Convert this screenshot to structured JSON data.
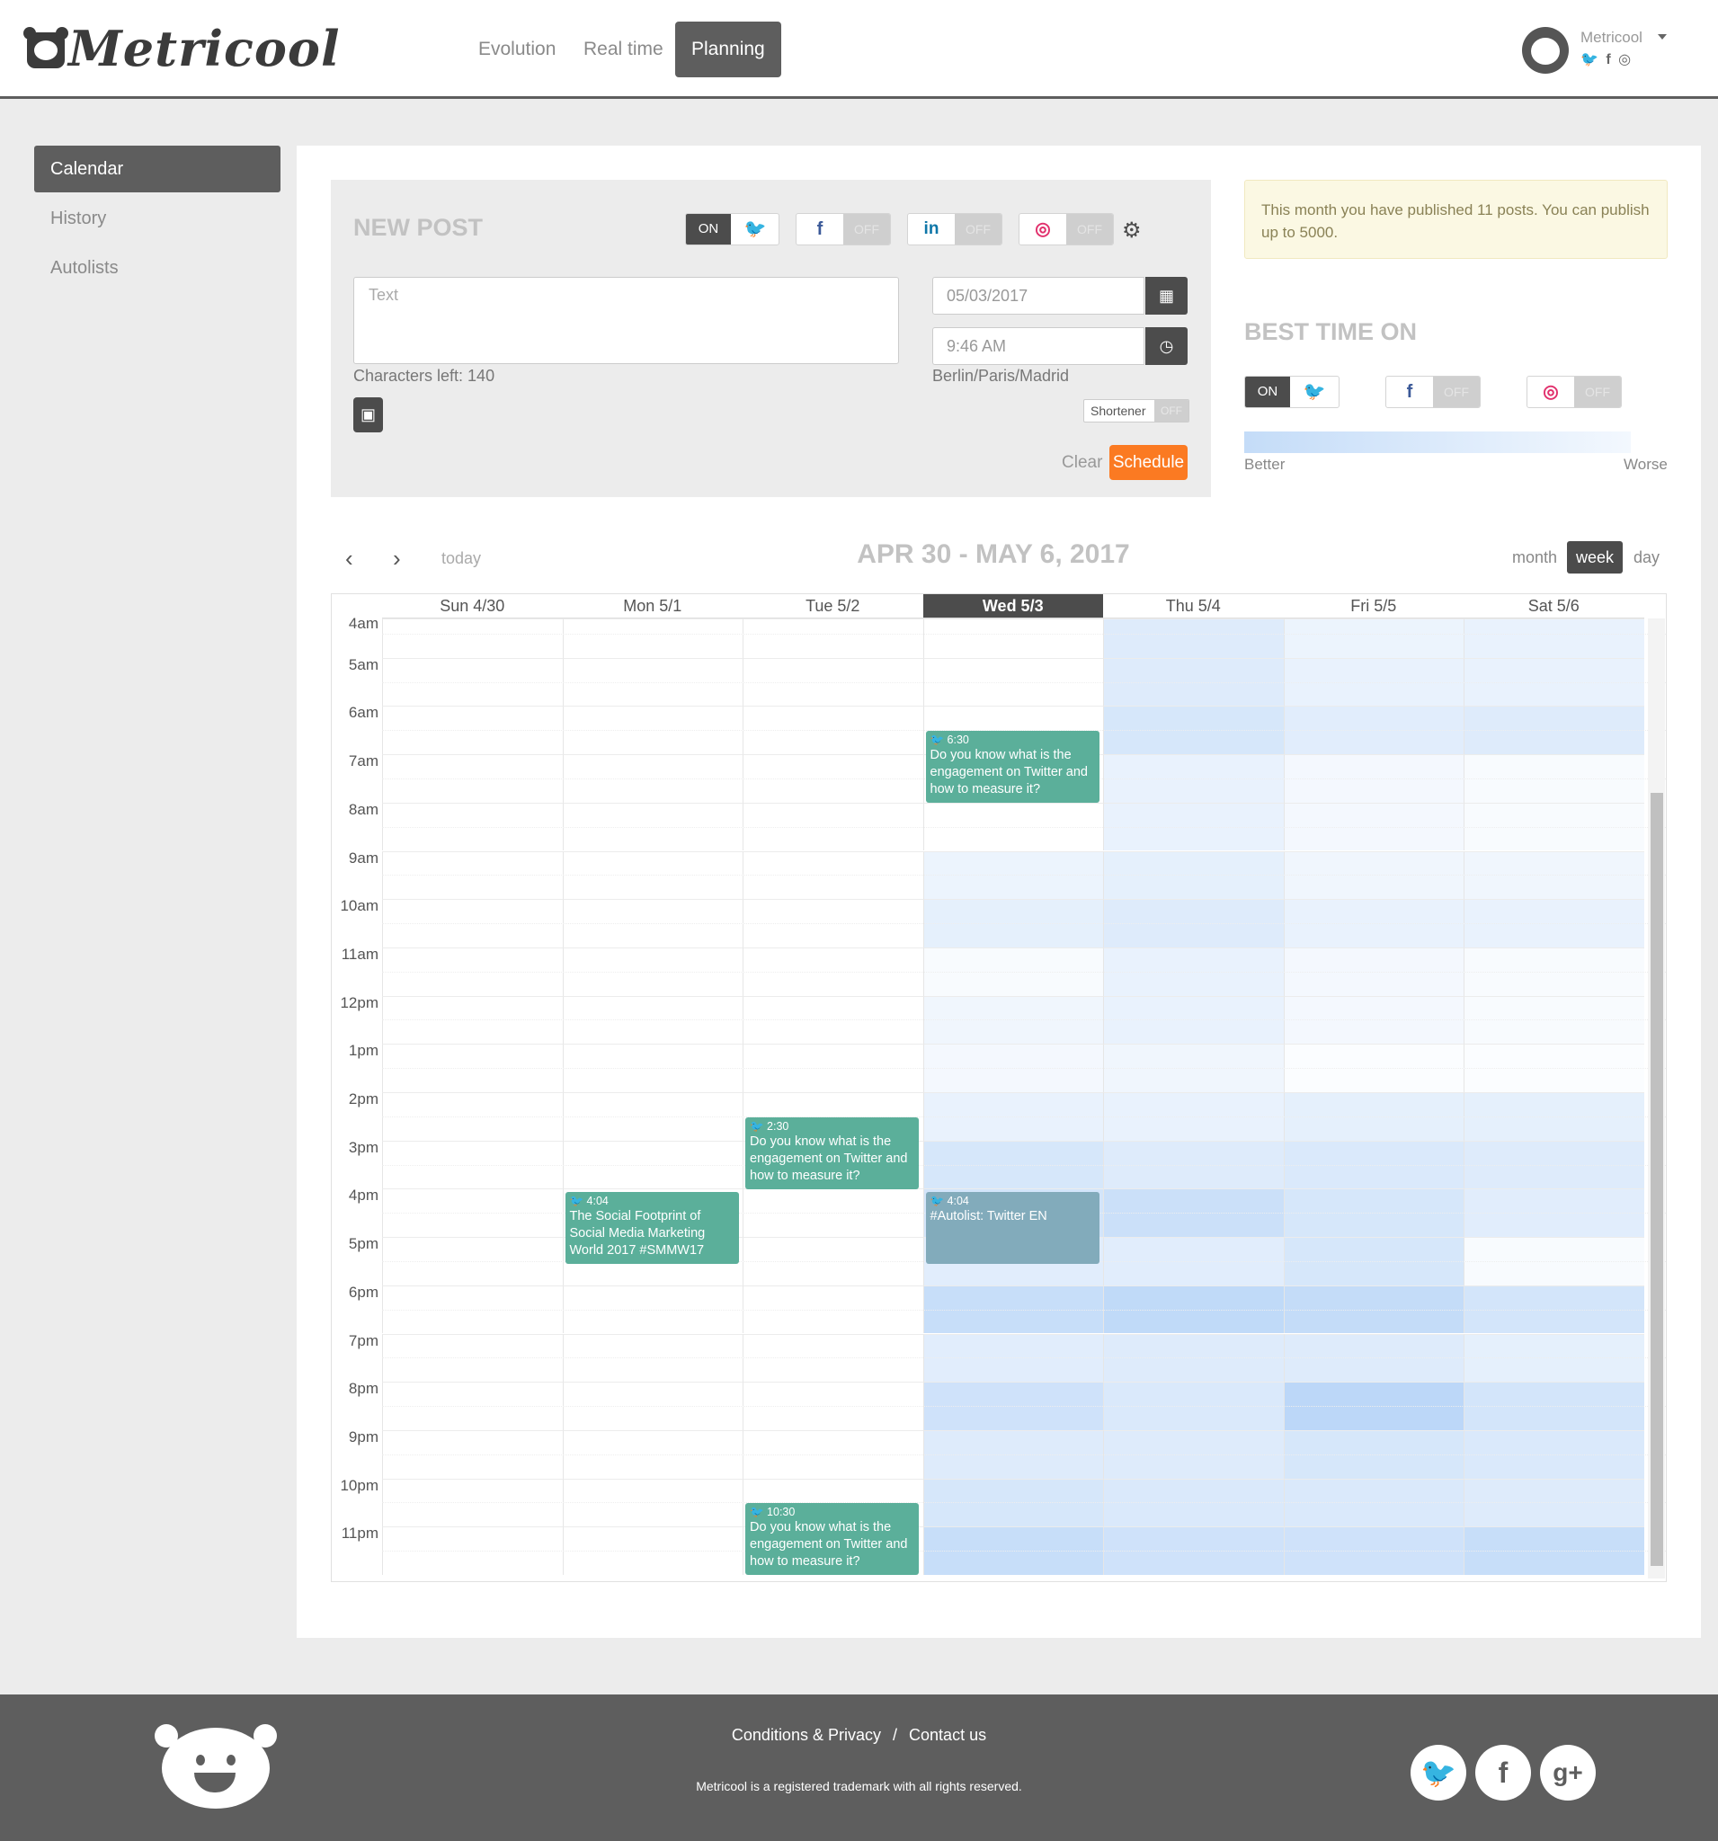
{
  "brand": {
    "name": "Metricool"
  },
  "nav": {
    "items": [
      "Evolution",
      "Real time",
      "Planning"
    ],
    "active": "Planning"
  },
  "account": {
    "name": "Metricool",
    "networks": "🐦 f ◎"
  },
  "sidebar": {
    "items": [
      "Calendar",
      "History",
      "Autolists"
    ],
    "active": "Calendar"
  },
  "new_post": {
    "title": "NEW POST",
    "on_label": "ON",
    "off_label": "OFF",
    "text_placeholder": "Text",
    "characters_left": "Characters left: 140",
    "date_value": "05/03/2017",
    "time_value": "9:46 AM",
    "timezone": "Berlin/Paris/Madrid",
    "shortener_label": "Shortener",
    "clear_label": "Clear",
    "schedule_label": "Schedule"
  },
  "notice": {
    "text": "This month you have published 11 posts. You can publish up to 5000."
  },
  "best_time": {
    "title": "BEST TIME ON",
    "on_label": "ON",
    "off_label": "OFF",
    "better_label": "Better",
    "worse_label": "Worse"
  },
  "calendar": {
    "title": "APR 30 - MAY 6, 2017",
    "today_label": "today",
    "views": [
      "month",
      "week",
      "day"
    ],
    "active_view": "week",
    "days": [
      "Sun 4/30",
      "Mon 5/1",
      "Tue 5/2",
      "Wed 5/3",
      "Thu 5/4",
      "Fri 5/5",
      "Sat 5/6"
    ],
    "current_day": "Wed 5/3",
    "hours": [
      "4am",
      "5am",
      "6am",
      "7am",
      "8am",
      "9am",
      "10am",
      "11am",
      "12pm",
      "1pm",
      "2pm",
      "3pm",
      "4pm",
      "5pm",
      "6pm",
      "7pm",
      "8pm",
      "9pm",
      "10pm",
      "11pm"
    ],
    "heat_levels": [
      [
        0,
        0,
        0,
        0,
        0.45,
        0.25,
        0.3
      ],
      [
        0,
        0,
        0,
        0,
        0.45,
        0.3,
        0.3
      ],
      [
        0,
        0,
        0,
        0,
        0.55,
        0.4,
        0.45
      ],
      [
        0,
        0,
        0,
        0,
        0.3,
        0.15,
        0.1
      ],
      [
        0,
        0,
        0,
        0,
        0.3,
        0.15,
        0.1
      ],
      [
        0,
        0,
        0,
        0.25,
        0.35,
        0.2,
        0.2
      ],
      [
        0,
        0,
        0,
        0.35,
        0.45,
        0.3,
        0.3
      ],
      [
        0,
        0,
        0,
        0.1,
        0.3,
        0.15,
        0.1
      ],
      [
        0,
        0,
        0,
        0.2,
        0.3,
        0.15,
        0.1
      ],
      [
        0,
        0,
        0,
        0.15,
        0.2,
        0.05,
        0.05
      ],
      [
        0,
        0,
        0,
        0.3,
        0.3,
        0.35,
        0.35
      ],
      [
        0,
        0,
        0,
        0.55,
        0.45,
        0.5,
        0.45
      ],
      [
        0,
        0,
        0,
        0.6,
        0.7,
        0.55,
        0.4
      ],
      [
        0,
        0,
        0,
        0.4,
        0.4,
        0.55,
        0.1
      ],
      [
        0,
        0,
        0,
        0.75,
        0.85,
        0.8,
        0.6
      ],
      [
        0,
        0,
        0,
        0.4,
        0.45,
        0.45,
        0.35
      ],
      [
        0,
        0,
        0,
        0.65,
        0.5,
        0.9,
        0.6
      ],
      [
        0,
        0,
        0,
        0.45,
        0.45,
        0.55,
        0.5
      ],
      [
        0,
        0,
        0,
        0.55,
        0.5,
        0.5,
        0.45
      ],
      [
        0,
        0,
        0,
        0.75,
        0.65,
        0.65,
        0.75
      ]
    ],
    "events": [
      {
        "day": "Wed 5/3",
        "time": "6:30",
        "start_hour": 6.5,
        "text": "Do you know what is the engagement on Twitter and how to measure it?",
        "color": "#5baf9a"
      },
      {
        "day": "Tue 5/2",
        "time": "2:30",
        "start_hour": 14.5,
        "text": "Do you know what is the engagement on Twitter and how to measure it?",
        "color": "#5baf9a"
      },
      {
        "day": "Mon 5/1",
        "time": "4:04",
        "start_hour": 16.04,
        "text": "The Social Footprint of Social Media Marketing World 2017 #SMMW17",
        "color": "#5baf9a"
      },
      {
        "day": "Wed 5/3",
        "time": "4:04",
        "start_hour": 16.04,
        "text": "#Autolist: Twitter EN",
        "color": "#82abbb"
      },
      {
        "day": "Tue 5/2",
        "time": "10:30",
        "start_hour": 22.5,
        "text": "Do you know what is the engagement on Twitter and how to measure it?",
        "color": "#5baf9a"
      }
    ]
  },
  "footer": {
    "conditions": "Conditions & Privacy",
    "separator": "/",
    "contact": "Contact us",
    "trademark": "Metricool is a registered trademark with all rights reserved."
  }
}
